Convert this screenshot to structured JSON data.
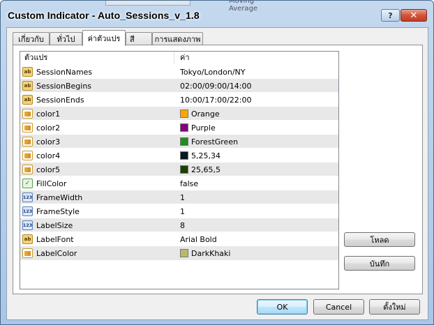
{
  "window": {
    "title": "Custom Indicator - Auto_Sessions_v_1.8",
    "background_hint": "Moving Average"
  },
  "titlebar": {
    "help_label": "?",
    "close_label": "✕"
  },
  "tabs": [
    {
      "label": "เกี่ยวกับ",
      "active": false
    },
    {
      "label": "ทั่วไป",
      "active": false
    },
    {
      "label": "ค่าตัวแปร",
      "active": true
    },
    {
      "label": "สี",
      "active": false
    },
    {
      "label": "การแสดงภาพ",
      "active": false
    }
  ],
  "grid": {
    "headers": {
      "name": "ตัวแปร",
      "value": "ค่า"
    },
    "rows": [
      {
        "icon": "ab",
        "name": "SessionNames",
        "value": "Tokyo/London/NY"
      },
      {
        "icon": "ab",
        "name": "SessionBegins",
        "value": "02:00/09:00/14:00"
      },
      {
        "icon": "ab",
        "name": "SessionEnds",
        "value": "10:00/17:00/22:00"
      },
      {
        "icon": "color",
        "name": "color1",
        "value": "Orange",
        "swatch": "#ffa500"
      },
      {
        "icon": "color",
        "name": "color2",
        "value": "Purple",
        "swatch": "#800080"
      },
      {
        "icon": "color",
        "name": "color3",
        "value": "ForestGreen",
        "swatch": "#228b22"
      },
      {
        "icon": "color",
        "name": "color4",
        "value": "5,25,34",
        "swatch": "#051922"
      },
      {
        "icon": "color",
        "name": "color5",
        "value": "25,65,5",
        "swatch": "#194105"
      },
      {
        "icon": "bool",
        "name": "FillColor",
        "value": "false"
      },
      {
        "icon": "123",
        "name": "FrameWidth",
        "value": "1"
      },
      {
        "icon": "123",
        "name": "FrameStyle",
        "value": "1"
      },
      {
        "icon": "123",
        "name": "LabelSize",
        "value": "8"
      },
      {
        "icon": "ab",
        "name": "LabelFont",
        "value": "Arial Bold"
      },
      {
        "icon": "color",
        "name": "LabelColor",
        "value": "DarkKhaki",
        "swatch": "#bdb76b"
      }
    ]
  },
  "side_buttons": {
    "load": "โหลด",
    "save": "บันทึก"
  },
  "footer": {
    "ok": "OK",
    "cancel": "Cancel",
    "reset": "ตั้งใหม่"
  },
  "colors": {
    "title_bar": "#b8d0ea",
    "alt_row": "#e8e8e8",
    "default_button_border": "#3c7fb1"
  }
}
